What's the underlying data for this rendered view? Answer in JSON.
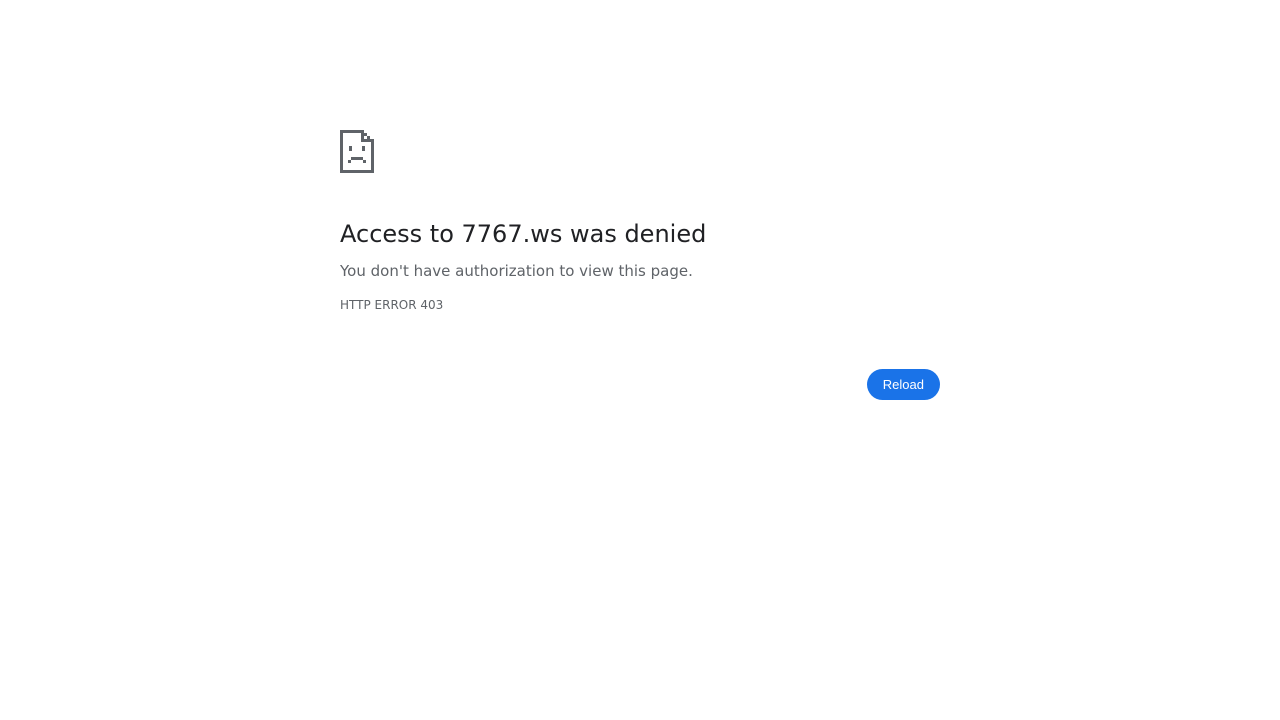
{
  "error": {
    "icon": "sad-page-icon",
    "headline": "Access to 7767.ws was denied",
    "message": "You don't have authorization to view this page.",
    "code": "HTTP ERROR 403"
  },
  "actions": {
    "reload_label": "Reload"
  },
  "colors": {
    "accent": "#1a73e8",
    "headline": "#202124",
    "secondary_text": "#5f6368",
    "icon": "#5f6368"
  }
}
